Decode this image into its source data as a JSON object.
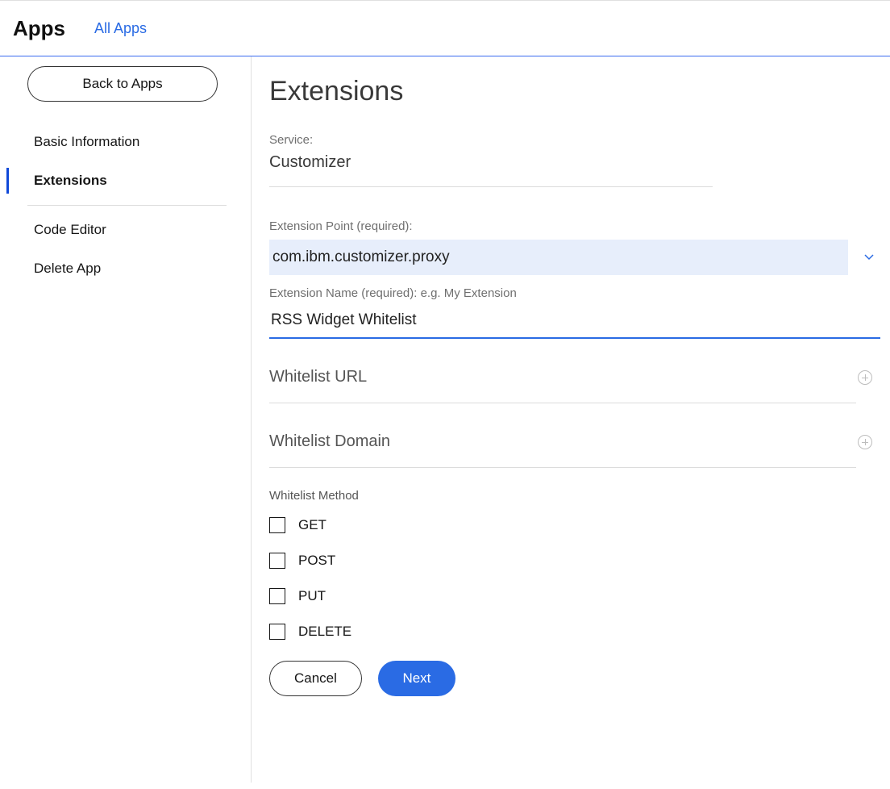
{
  "topbar": {
    "title": "Apps",
    "link": "All Apps"
  },
  "sidebar": {
    "back_label": "Back to Apps",
    "items": [
      {
        "label": "Basic Information",
        "active": false
      },
      {
        "label": "Extensions",
        "active": true
      }
    ],
    "secondary": [
      {
        "label": "Code Editor"
      },
      {
        "label": "Delete App"
      }
    ]
  },
  "main": {
    "title": "Extensions",
    "service_label": "Service:",
    "service_value": "Customizer",
    "ext_point_label": "Extension Point (required):",
    "ext_point_value": "com.ibm.customizer.proxy",
    "ext_name_label": "Extension Name (required): e.g. My Extension",
    "ext_name_value": "RSS Widget Whitelist",
    "whitelist_url_label": "Whitelist URL",
    "whitelist_domain_label": "Whitelist Domain",
    "whitelist_method_label": "Whitelist Method",
    "methods": [
      {
        "label": "GET",
        "checked": false
      },
      {
        "label": "POST",
        "checked": false
      },
      {
        "label": "PUT",
        "checked": false
      },
      {
        "label": "DELETE",
        "checked": false
      }
    ],
    "cancel_label": "Cancel",
    "next_label": "Next"
  }
}
